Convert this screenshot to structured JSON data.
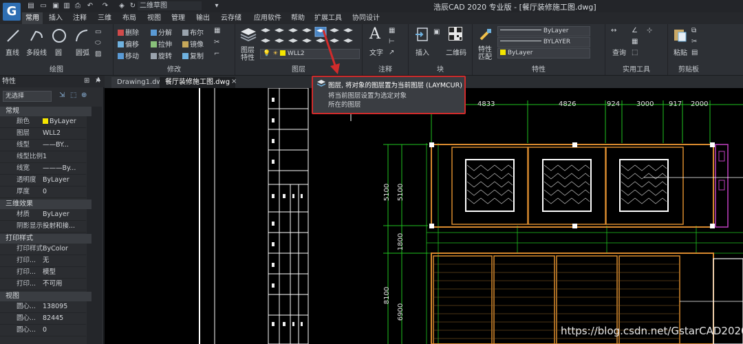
{
  "window": {
    "title": "浩辰CAD 2020 专业版 - [餐厅装修施工图.dwg]",
    "workspace": "二维草图",
    "logo": "G"
  },
  "menu_tabs": [
    "常用",
    "插入",
    "注释",
    "三维",
    "布局",
    "视图",
    "管理",
    "输出",
    "云存储",
    "应用软件",
    "帮助",
    "扩展工具",
    "协同设计"
  ],
  "ribbon": {
    "draw": {
      "title": "绘图",
      "buttons": [
        "直线",
        "多段线",
        "圆",
        "圆弧"
      ]
    },
    "modify": {
      "title": "修改",
      "buttons": [
        "删除",
        "分解",
        "布尔",
        "偏移",
        "拉伸",
        "镜像",
        "移动",
        "旋转",
        "复制"
      ]
    },
    "layer": {
      "title": "图层",
      "props_label": "图层\n特性",
      "current_layer": "WLL2"
    },
    "annotate": {
      "title": "注释",
      "text_label": "文字"
    },
    "block": {
      "title": "块",
      "insert_label": "插入",
      "qrcode_label": "二维码"
    },
    "properties": {
      "title": "特性",
      "match_label": "特性\n匹配",
      "bylayer1": "ByLayer",
      "bylayer2": "BYLAYER",
      "bylayer3": "ByLayer"
    },
    "utilities": {
      "title": "实用工具",
      "query_label": "查询"
    },
    "clipboard": {
      "title": "剪贴板",
      "paste_label": "粘贴"
    }
  },
  "doc_tabs": [
    "Drawing1.dwg",
    "餐厅装修施工图.dwg"
  ],
  "tooltip": {
    "title": "图层, 将对象的图层置为当前图层 (LAYMCUR)",
    "line1": "将当前图层设置为选定对象",
    "line2": "所在的图层"
  },
  "properties_panel": {
    "header": "特性",
    "selection": "无选择",
    "sections": [
      {
        "name": "常规",
        "rows": [
          [
            "颜色",
            "ByLayer"
          ],
          [
            "图层",
            "WLL2"
          ],
          [
            "线型",
            "——BY..."
          ],
          [
            "线型比例",
            "1"
          ],
          [
            "线宽",
            "———By..."
          ],
          [
            "透明度",
            "ByLayer"
          ],
          [
            "厚度",
            "0"
          ]
        ]
      },
      {
        "name": "三维效果",
        "rows": [
          [
            "材质",
            "ByLayer"
          ],
          [
            "阴影显示",
            "投射和接..."
          ]
        ]
      },
      {
        "name": "打印样式",
        "rows": [
          [
            "打印样式",
            "ByColor"
          ],
          [
            "打印...",
            "无"
          ],
          [
            "打印...",
            "模型"
          ],
          [
            "打印...",
            "不可用"
          ]
        ]
      },
      {
        "name": "视图",
        "rows": [
          [
            "圆心...",
            "138095"
          ],
          [
            "圆心...",
            "82445"
          ],
          [
            "圆心...",
            "0"
          ]
        ]
      }
    ]
  },
  "drawing_dims": {
    "top": [
      "4833",
      "4826",
      "924",
      "3000",
      "917",
      "2000"
    ],
    "left": [
      "5100",
      "5100",
      "1800",
      "8100",
      "6900"
    ]
  },
  "watermark": "https://blog.csdn.net/GstarCAD2020",
  "colors": {
    "accent_red": "#d12b2b",
    "grid_green": "#1fc41f",
    "wall_orange": "#d98a2e",
    "ribbon_bg": "#2d3035"
  }
}
